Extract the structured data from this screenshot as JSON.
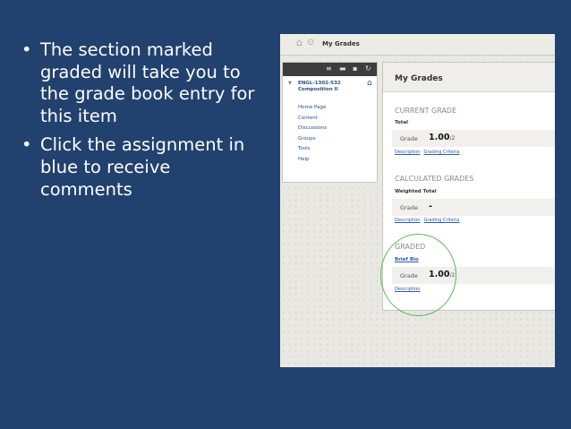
{
  "bullets": [
    {
      "symbol": "•",
      "text": "The section marked graded will take you to the grade book entry for this item"
    },
    {
      "symbol": "•",
      "text": "Click the assignment in blue to receive comments"
    }
  ],
  "screenshot": {
    "breadcrumb": "My Grades",
    "course_menu": {
      "course_title_line1": "ENGL-1302-532",
      "course_title_line2": "Composition II",
      "items": [
        "Home Page",
        "Content",
        "Discussions",
        "Groups",
        "Tools",
        "Help"
      ]
    },
    "grades_panel": {
      "title": "My Grades",
      "current_grade": {
        "heading": "CURRENT GRADE",
        "label": "Total",
        "grade_label": "Grade",
        "grade_value": "1.00",
        "grade_outof": "/2",
        "links": [
          "Description",
          "Grading Criteria"
        ]
      },
      "calculated_grades": {
        "heading": "CALCULATED GRADES",
        "label": "Weighted Total",
        "grade_label": "Grade",
        "grade_value": "-",
        "links": [
          "Description",
          "Grading Criteria"
        ]
      },
      "graded": {
        "heading": "GRADED",
        "item_link": "Brief Bio",
        "grade_label": "Grade",
        "grade_value": "1.00",
        "grade_outof": "/2",
        "links": [
          "Description"
        ]
      }
    }
  },
  "colors": {
    "slide_background": "#21416f",
    "link_blue": "#2b5aa8",
    "highlight_circle": "#5db85d"
  }
}
